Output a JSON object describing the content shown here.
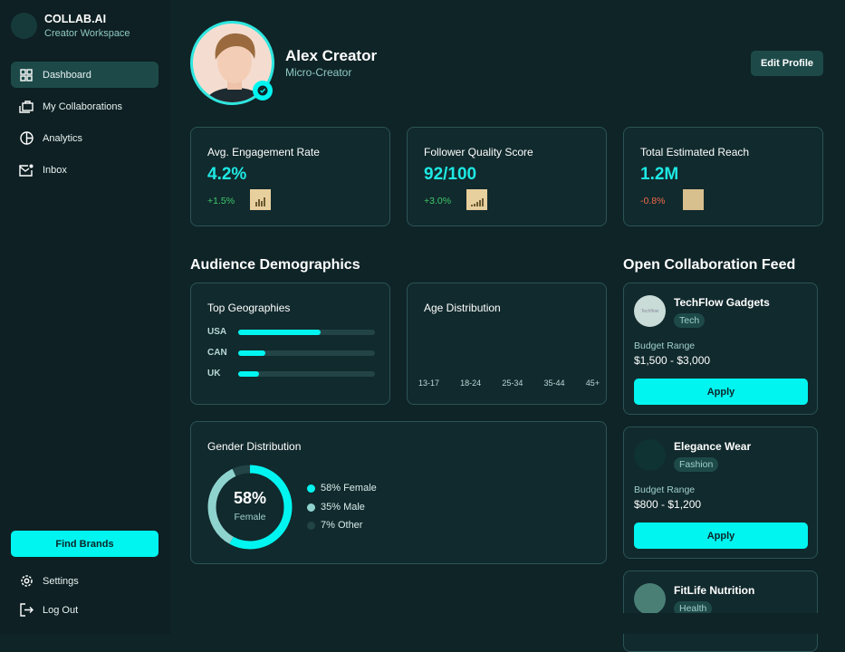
{
  "sidebar": {
    "brand": "COLLAB.AI",
    "subtitle": "Creator Workspace",
    "nav": [
      {
        "label": "Dashboard",
        "icon": "grid-icon"
      },
      {
        "label": "My Collaborations",
        "icon": "briefcase-icon"
      },
      {
        "label": "Analytics",
        "icon": "pie-chart-icon"
      },
      {
        "label": "Inbox",
        "icon": "mail-icon"
      }
    ],
    "find_brands": "Find Brands",
    "settings": "Settings",
    "logout": "Log Out"
  },
  "profile": {
    "name": "Alex Creator",
    "role": "Micro-Creator",
    "edit": "Edit Profile"
  },
  "stats": [
    {
      "label": "Avg. Engagement Rate",
      "value": "4.2%",
      "change": "+1.5%",
      "trend": "up"
    },
    {
      "label": "Follower Quality Score",
      "value": "92/100",
      "change": "+3.0%",
      "trend": "up"
    },
    {
      "label": "Total Estimated Reach",
      "value": "1.2M",
      "change": "-0.8%",
      "trend": "down"
    }
  ],
  "demographics": {
    "title": "Audience Demographics",
    "geo": {
      "title": "Top Geographies",
      "rows": [
        {
          "label": "USA",
          "pct": 60
        },
        {
          "label": "CAN",
          "pct": 20
        },
        {
          "label": "UK",
          "pct": 15
        }
      ]
    },
    "age": {
      "title": "Age Distribution",
      "labels": [
        "13-17",
        "18-24",
        "25-34",
        "35-44",
        "45+"
      ]
    },
    "gender": {
      "title": "Gender Distribution",
      "center_value": "58%",
      "center_label": "Female",
      "legend": [
        {
          "label": "58% Female",
          "pct": 58,
          "color": "#00f5f0"
        },
        {
          "label": "35% Male",
          "pct": 35,
          "color": "#8fd3cf"
        },
        {
          "label": "7% Other",
          "pct": 7,
          "color": "#224446"
        }
      ]
    }
  },
  "feed": {
    "title": "Open Collaboration Feed",
    "budget_label": "Budget Range",
    "apply": "Apply",
    "items": [
      {
        "name": "TechFlow Gadgets",
        "tag": "Tech",
        "budget": "$1,500 - $3,000",
        "logo_text": "Techflow"
      },
      {
        "name": "Elegance Wear",
        "tag": "Fashion",
        "budget": "$800 - $1,200"
      },
      {
        "name": "FitLife Nutrition",
        "tag": "Health"
      }
    ]
  },
  "colors": {
    "accent": "#00f5f0",
    "positive": "#3ec96a",
    "negative": "#f06a4a"
  }
}
